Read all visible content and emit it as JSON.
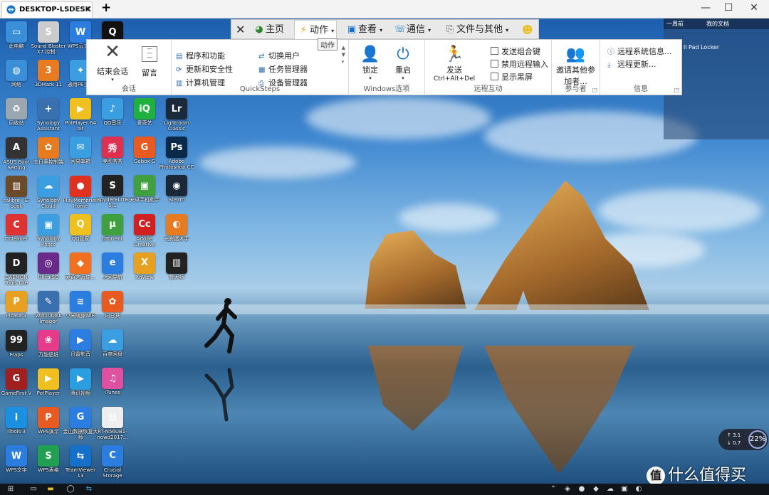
{
  "window": {
    "tab_title": "DESKTOP-LSDESK",
    "star_icon": "star-icon",
    "close_icon": "close-icon",
    "new_tab": "+",
    "minimize": "—",
    "maximize": "☐",
    "close": "✕"
  },
  "tv_tabs": [
    {
      "label": "",
      "icon": "close-icon"
    },
    {
      "label": "主页",
      "icon": "home-icon"
    },
    {
      "label": "动作",
      "icon": "lightning-icon"
    },
    {
      "label": "查看",
      "icon": "monitor-icon"
    },
    {
      "label": "通信",
      "icon": "phone-icon"
    },
    {
      "label": "文件与其他",
      "icon": "file-icon"
    },
    {
      "label": "",
      "icon": "smiley-icon"
    }
  ],
  "tooltip": "动作",
  "ribbon": {
    "session": {
      "end": "结束会话",
      "msg": "留言",
      "label": "会话"
    },
    "quicksteps": {
      "items": [
        "程序和功能",
        "更新和安全性",
        "计算机管理",
        "切换用户",
        "任务管理器",
        "设备管理器"
      ],
      "label": "QuickSteps"
    },
    "windows": {
      "lock": "锁定",
      "restart": "重启",
      "label": "Windows选项"
    },
    "remote": {
      "send": "发送",
      "cad": "Ctrl+Alt+Del",
      "checks": [
        "发送组合键",
        "禁用远程输入",
        "显示黑屏"
      ],
      "label": "远程互动"
    },
    "participants": {
      "invite_line1": "邀请其他参",
      "invite_line2": "加者...",
      "label": "参与者"
    },
    "info": {
      "items": [
        "远程系统信息...",
        "远程更新..."
      ],
      "label": "信息"
    }
  },
  "right_panel": {
    "head_left": "一周前",
    "head_right": "我的文档",
    "item": "ll Pad Locker"
  },
  "speed": {
    "up": "3.1",
    "down": "0.7",
    "percent": "22"
  },
  "watermark": {
    "logo": "值",
    "text": "什么值得买"
  },
  "desktop_icons": [
    {
      "label": "此电脑",
      "color": "#3b8fd8",
      "glyph": "▭"
    },
    {
      "label": "网络",
      "color": "#3b8fd8",
      "glyph": "◍"
    },
    {
      "label": "回收站",
      "color": "#9aa6b0",
      "glyph": "♻"
    },
    {
      "label": "ASUS Boot Setting",
      "color": "#333",
      "glyph": "A"
    },
    {
      "label": "calibre - E-book manag...",
      "color": "#6b4a2a",
      "glyph": "▥"
    },
    {
      "label": "CCleaner",
      "color": "#d33",
      "glyph": "C"
    },
    {
      "label": "DAEMON Tools Lite",
      "color": "#222",
      "glyph": "D"
    },
    {
      "label": "Picasa 3",
      "color": "#e8a020",
      "glyph": "P"
    },
    {
      "label": "Fraps",
      "color": "#222",
      "glyph": "99"
    },
    {
      "label": "GameFirst V",
      "color": "#a02020",
      "glyph": "G"
    },
    {
      "label": "iTools 3",
      "color": "#1b8fe0",
      "glyph": "i"
    },
    {
      "label": "WPS文字",
      "color": "#2b7de0",
      "glyph": "W"
    },
    {
      "label": "Sound Blaster X7 控制...",
      "color": "#ccc",
      "glyph": "S"
    },
    {
      "label": "3DMark 11",
      "color": "#e87a20",
      "glyph": "3"
    },
    {
      "label": "Synology Assistant",
      "color": "#3a6fb0",
      "glyph": "+"
    },
    {
      "label": "向日葵控制端",
      "color": "#e87a20",
      "glyph": "✿"
    },
    {
      "label": "Synology Cloud Station...",
      "color": "#3a9ee0",
      "glyph": "☁"
    },
    {
      "label": "Synology Photo Station...",
      "color": "#3a9ee0",
      "glyph": "▣"
    },
    {
      "label": "UltraISO",
      "color": "#6a2a8a",
      "glyph": "◎"
    },
    {
      "label": "Win10Disk Imager",
      "color": "#3a6fb0",
      "glyph": "✎"
    },
    {
      "label": "万能壁纸",
      "color": "#e83a8a",
      "glyph": "❀"
    },
    {
      "label": "PotPlayer",
      "color": "#f0c020",
      "glyph": "▶"
    },
    {
      "label": "WPS演示",
      "color": "#e85a20",
      "glyph": "P"
    },
    {
      "label": "WPS表格",
      "color": "#20a050",
      "glyph": "S"
    },
    {
      "label": "WPS云文...",
      "color": "#2b7de0",
      "glyph": "W"
    },
    {
      "label": "通用PE工...",
      "color": "#3a9ee0",
      "glyph": "✦"
    },
    {
      "label": "PotPlayer 64 bit",
      "color": "#f0c020",
      "glyph": "▶"
    },
    {
      "label": "网易邮箱",
      "color": "#3a9ee0",
      "glyph": "✉"
    },
    {
      "label": "PlayMemories Home",
      "color": "#e03020",
      "glyph": "●"
    },
    {
      "label": "QQ管家",
      "color": "#f0c020",
      "glyph": "Q"
    },
    {
      "label": "爱奇艺万能...",
      "color": "#f07020",
      "glyph": "◆"
    },
    {
      "label": "小米随身WiFi",
      "color": "#2b7de0",
      "glyph": "≋"
    },
    {
      "label": "迅雷影音",
      "color": "#2b7de0",
      "glyph": "▶"
    },
    {
      "label": "腾讯视频",
      "color": "#2b9ee0",
      "glyph": "▶"
    },
    {
      "label": "金山数据恢复大师",
      "color": "#2b7de0",
      "glyph": "G"
    },
    {
      "label": "TeamViewer 13",
      "color": "#1470c8",
      "glyph": "⇆"
    },
    {
      "label": "QQ",
      "color": "#111",
      "glyph": "Q"
    },
    {
      "label": "QQ音乐",
      "color": "#3a9ee0",
      "glyph": "♪"
    },
    {
      "label": "美图秀秀",
      "color": "#e03050",
      "glyph": "秀"
    },
    {
      "label": "SpyderELITE 5.1",
      "color": "#222",
      "glyph": "S"
    },
    {
      "label": "µTorrent",
      "color": "#40a040",
      "glyph": "µ"
    },
    {
      "label": "上网导航",
      "color": "#2b7de0",
      "glyph": "e"
    },
    {
      "label": "向日葵",
      "color": "#e85a20",
      "glyph": "✿"
    },
    {
      "label": "百度网盘",
      "color": "#3a9ee0",
      "glyph": "☁"
    },
    {
      "label": "iTunes",
      "color": "#e050a0",
      "glyph": "♫"
    },
    {
      "label": "RT-N56UB1-newd2017...",
      "color": "#eee",
      "glyph": "▤"
    },
    {
      "label": "Crucial Storage Executive",
      "color": "#2b7de0",
      "glyph": "C"
    },
    {
      "label": "爱奇艺",
      "color": "#20b040",
      "glyph": "iQ"
    },
    {
      "label": "Gobox G",
      "color": "#e85a20",
      "glyph": "G"
    },
    {
      "label": "安卓手机助手",
      "color": "#40a040",
      "glyph": "▣"
    },
    {
      "label": "Adobe Creative Cloud",
      "color": "#d02020",
      "glyph": "Cc"
    },
    {
      "label": "XnView",
      "color": "#e8a020",
      "glyph": "X"
    },
    {
      "label": "Lightroom Classic",
      "color": "#1a2a3a",
      "glyph": "Lr"
    },
    {
      "label": "Adobe Photoshop CC 2018",
      "color": "#0b2a4a",
      "glyph": "Ps"
    },
    {
      "label": "Steam",
      "color": "#1b2838",
      "glyph": "◉"
    },
    {
      "label": "光影魔术手",
      "color": "#e87a20",
      "glyph": "◐"
    },
    {
      "label": "鲁大师",
      "color": "#222",
      "glyph": "▥"
    }
  ],
  "taskbar": {
    "time": ""
  }
}
